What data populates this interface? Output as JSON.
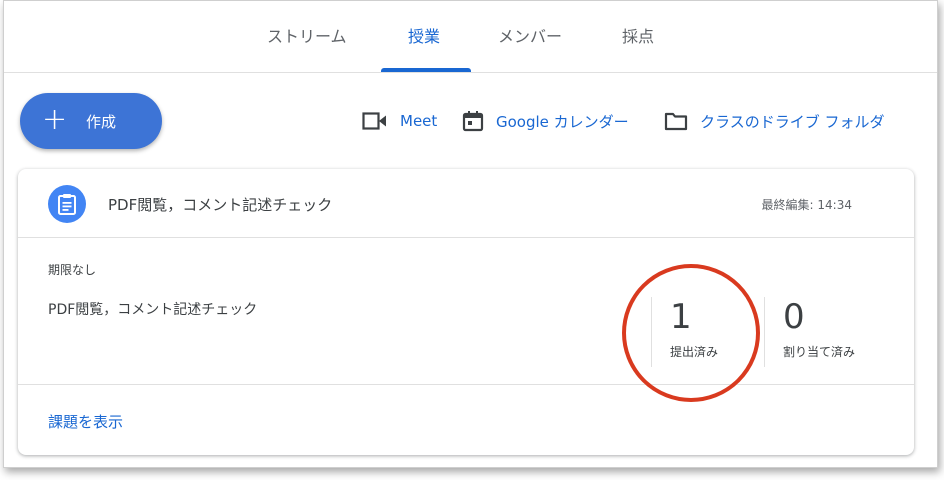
{
  "tabs": [
    {
      "label": "ストリーム"
    },
    {
      "label": "授業"
    },
    {
      "label": "メンバー"
    },
    {
      "label": "採点"
    }
  ],
  "create_button": {
    "label": "作成",
    "icon": "plus-icon"
  },
  "links": {
    "meet": "Meet",
    "calendar": "Google カレンダー",
    "folder": "クラスのドライブ フォルダ"
  },
  "assignment": {
    "title": "PDF閲覧，コメント記述チェック",
    "edited": "最終編集: 14:34",
    "due": "期限なし",
    "description": "PDF閲覧，コメント記述チェック",
    "turned_in": {
      "count": "1",
      "label": "提出済み"
    },
    "assigned": {
      "count": "0",
      "label": "割り当て済み"
    },
    "view_link": "課題を表示"
  },
  "colors": {
    "accent": "#1967d2",
    "create_button": "#3d74d6",
    "annotation_circle": "#d93a1f"
  }
}
